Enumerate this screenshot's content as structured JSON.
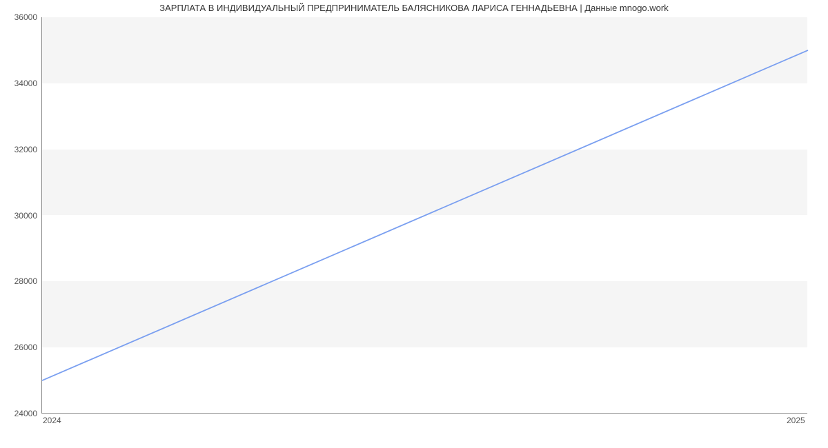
{
  "chart_data": {
    "type": "line",
    "title": "ЗАРПЛАТА В ИНДИВИДУАЛЬНЫЙ ПРЕДПРИНИМАТЕЛЬ БАЛЯСНИКОВА ЛАРИСА ГЕННАДЬЕВНА | Данные mnogo.work",
    "xlabel": "",
    "ylabel": "",
    "x_ticks": [
      "2024",
      "2025"
    ],
    "y_ticks": [
      24000,
      26000,
      28000,
      30000,
      32000,
      34000,
      36000
    ],
    "ylim": [
      24000,
      36000
    ],
    "xlim": [
      2024,
      2025
    ],
    "series": [
      {
        "name": "salary",
        "x": [
          2024,
          2025
        ],
        "values": [
          25000,
          35000
        ],
        "color": "#7a9ff0"
      }
    ],
    "bands": true
  }
}
